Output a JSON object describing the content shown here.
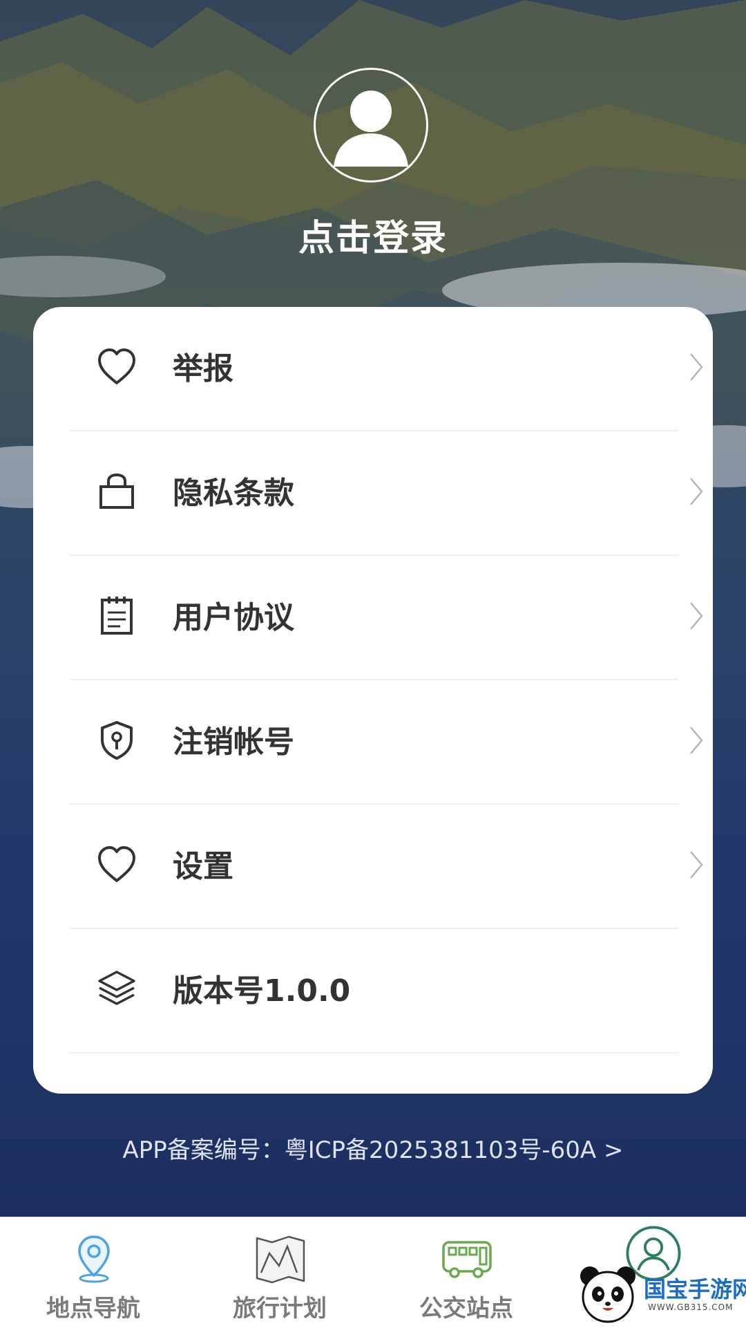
{
  "header": {
    "login_label": "点击登录"
  },
  "menu": [
    {
      "label": "举报",
      "icon": "heart-icon",
      "chevron": true
    },
    {
      "label": "隐私条款",
      "icon": "lock-bag-icon",
      "chevron": true
    },
    {
      "label": "用户协议",
      "icon": "notepad-icon",
      "chevron": true
    },
    {
      "label": "注销帐号",
      "icon": "shield-keyhole-icon",
      "chevron": true
    },
    {
      "label": "设置",
      "icon": "heart-icon",
      "chevron": true
    },
    {
      "label": "版本号1.0.0",
      "icon": "layers-icon",
      "chevron": false
    }
  ],
  "footer": {
    "icp": "APP备案编号：粤ICP备2025381103号-60A >"
  },
  "tabs": [
    {
      "label": "地点导航",
      "icon": "location-pin-icon",
      "color": "#4aa3e8"
    },
    {
      "label": "旅行计划",
      "icon": "map-fold-icon",
      "color": "#555555"
    },
    {
      "label": "公交站点",
      "icon": "bus-icon",
      "color": "#6aa84f"
    },
    {
      "label": "",
      "icon": "user-circle-icon",
      "color": "#2e7d5b"
    }
  ],
  "watermark": {
    "text": "国宝手游网",
    "url": "WWW.GB315.COM"
  }
}
